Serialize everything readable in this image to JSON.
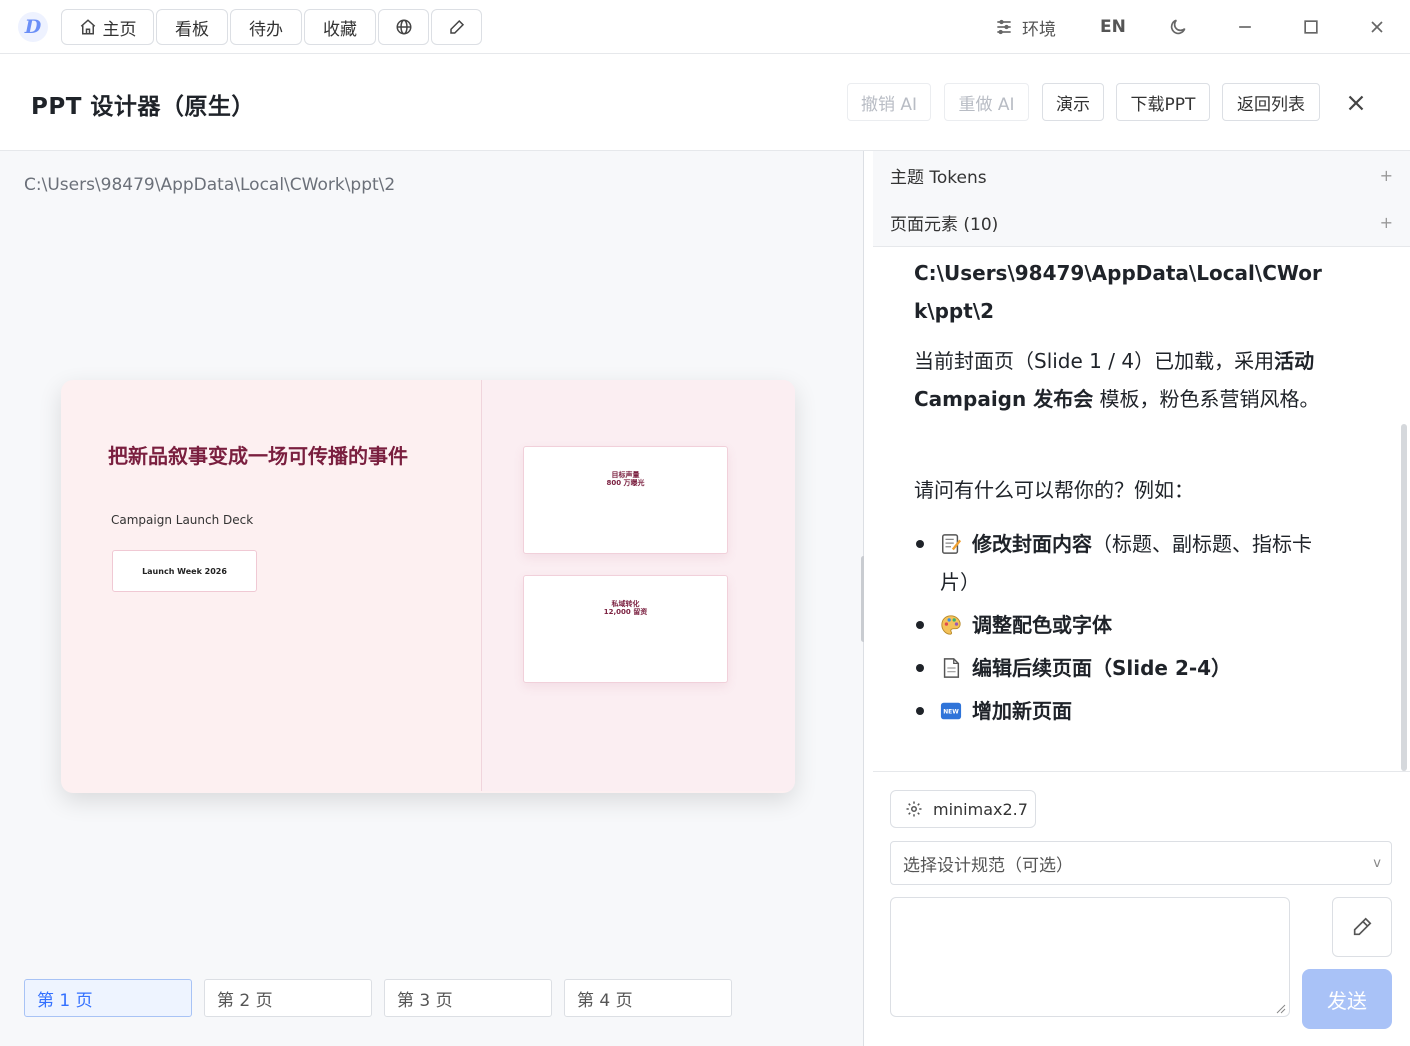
{
  "topbar": {
    "logo_letter": "D",
    "nav": [
      {
        "label": "主页",
        "icon": "home-icon"
      },
      {
        "label": "看板"
      },
      {
        "label": "待办"
      },
      {
        "label": "收藏"
      }
    ],
    "globe_icon": "globe-icon",
    "edit_icon": "pencil-icon",
    "env_label": "环境",
    "lang_label": "EN",
    "theme_icon": "moon-icon",
    "window_controls": [
      "minimize-icon",
      "maximize-icon",
      "close-icon"
    ]
  },
  "header": {
    "title": "PPT 设计器（原生）",
    "undo_ai": "撤销 AI",
    "redo_ai": "重做 AI",
    "present": "演示",
    "download": "下载PPT",
    "back": "返回列表"
  },
  "left": {
    "path": "C:\\Users\\98479\\AppData\\Local\\CWork\\ppt\\2",
    "slide": {
      "title": "把新品叙事变成一场可传播的事件",
      "subtitle": "Campaign Launch Deck",
      "badge": "Launch Week 2026",
      "cards": [
        {
          "line1": "目标声量",
          "line2": "800 万曝光"
        },
        {
          "line1": "私域转化",
          "line2": "12,000 留资"
        }
      ]
    },
    "pages": [
      {
        "label": "第 1 页",
        "active": true
      },
      {
        "label": "第 2 页",
        "active": false
      },
      {
        "label": "第 3 页",
        "active": false
      },
      {
        "label": "第 4 页",
        "active": false
      }
    ]
  },
  "right": {
    "accordion": [
      {
        "label": "主题 Tokens",
        "toggle": "+"
      },
      {
        "label": "页面元素 (10)",
        "toggle": "+"
      }
    ],
    "chat": {
      "path": "C:\\Users\\98479\\AppData\\Local\\CWork\\ppt\\2",
      "p1_a": "当前封面页（Slide 1 / 4）已加载，采用",
      "p1_bold": "活动 Campaign 发布会",
      "p1_b": " 模板，粉色系营销风格。",
      "p2": "请问有什么可以帮你的？例如：",
      "bullets": [
        {
          "icon": "memo-icon",
          "bold": "修改封面内容",
          "rest": "（标题、副标题、指标卡片）"
        },
        {
          "icon": "palette-icon",
          "bold": "调整配色或字体",
          "rest": ""
        },
        {
          "icon": "page-icon",
          "bold": "编辑后续页面（Slide 2-4）",
          "rest": ""
        },
        {
          "icon": "new-icon",
          "bold": "增加新页面",
          "rest": ""
        }
      ]
    },
    "model": "minimax2.7",
    "design_select_placeholder": "选择设计规范（可选）",
    "select_caret": "v",
    "send": "发送"
  },
  "colors": {
    "accent": "#3370ff",
    "slide_title": "#7a1f3f",
    "slide_bg": "#fdf0f1",
    "send_disabled": "#a9c2f7"
  }
}
